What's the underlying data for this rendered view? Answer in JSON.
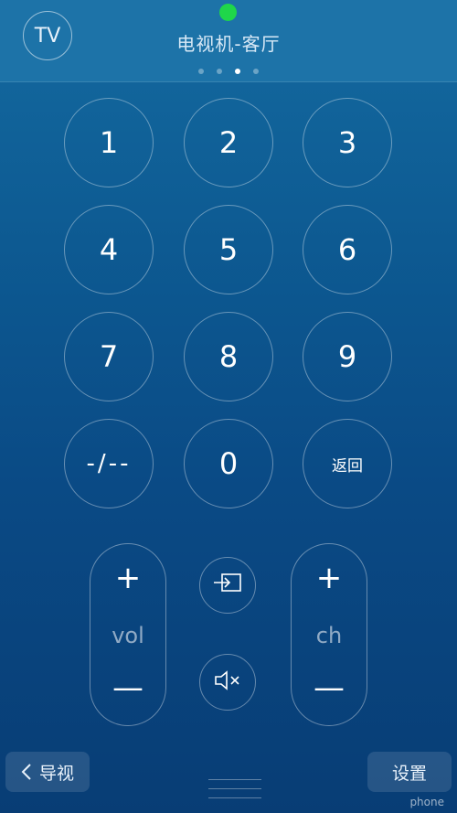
{
  "header": {
    "tv_label": "TV",
    "title": "电视机-客厅",
    "page_count": 4,
    "active_page": 3,
    "status_color": "#1fd64a"
  },
  "keypad": {
    "k1": "1",
    "k2": "2",
    "k3": "3",
    "k4": "4",
    "k5": "5",
    "k6": "6",
    "k7": "7",
    "k8": "8",
    "k9": "9",
    "digits_toggle": "-/--",
    "k0": "0",
    "back": "返回"
  },
  "controls": {
    "vol_label": "vol",
    "ch_label": "ch",
    "plus": "+",
    "minus": "—",
    "input_icon": "input-source-icon",
    "mute_icon": "mute-icon"
  },
  "footer": {
    "guide_label": "导视",
    "settings_label": "设置",
    "watermark": "phone"
  }
}
